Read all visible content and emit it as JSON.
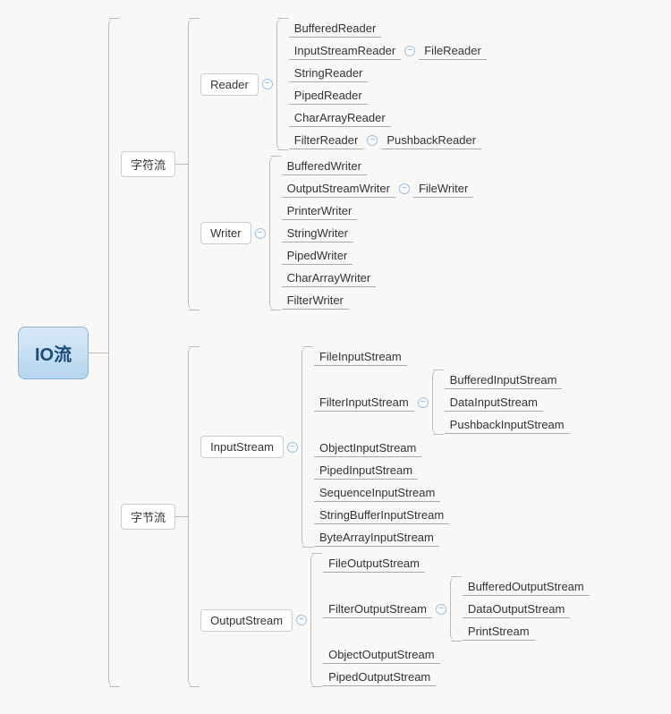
{
  "root": "IO流",
  "charStream": {
    "label": "字符流"
  },
  "byteStream": {
    "label": "字节流"
  },
  "reader": {
    "label": "Reader",
    "children": {
      "buffered": "BufferedReader",
      "inputStream": "InputStreamReader",
      "fileReader": "FileReader",
      "string": "StringReader",
      "piped": "PipedReader",
      "charArray": "CharArrayReader",
      "filter": "FilterReader",
      "pushback": "PushbackReader"
    }
  },
  "writer": {
    "label": "Writer",
    "children": {
      "buffered": "BufferedWriter",
      "outputStream": "OutputStreamWriter",
      "fileWriter": "FileWriter",
      "printer": "PrinterWriter",
      "string": "StringWriter",
      "piped": "PipedWriter",
      "charArray": "CharArrayWriter",
      "filter": "FilterWriter"
    }
  },
  "inputStream": {
    "label": "InputStream",
    "children": {
      "file": "FileInputStream",
      "filter": "FilterInputStream",
      "filterChildren": {
        "buffered": "BufferedInputStream",
        "data": "DataInputStream",
        "pushback": "PushbackInputStream"
      },
      "object": "ObjectInputStream",
      "piped": "PipedInputStream",
      "sequence": "SequenceInputStream",
      "stringBuffer": "StringBufferInputStream",
      "byteArray": "ByteArrayInputStream"
    }
  },
  "outputStream": {
    "label": "OutputStream",
    "children": {
      "file": "FileOutputStream",
      "filter": "FilterOutputStream",
      "filterChildren": {
        "buffered": "BufferedOutputStream",
        "data": "DataOutputStream",
        "print": "PrintStream"
      },
      "object": "ObjectOutputStream",
      "piped": "PipedOutputStream"
    }
  }
}
